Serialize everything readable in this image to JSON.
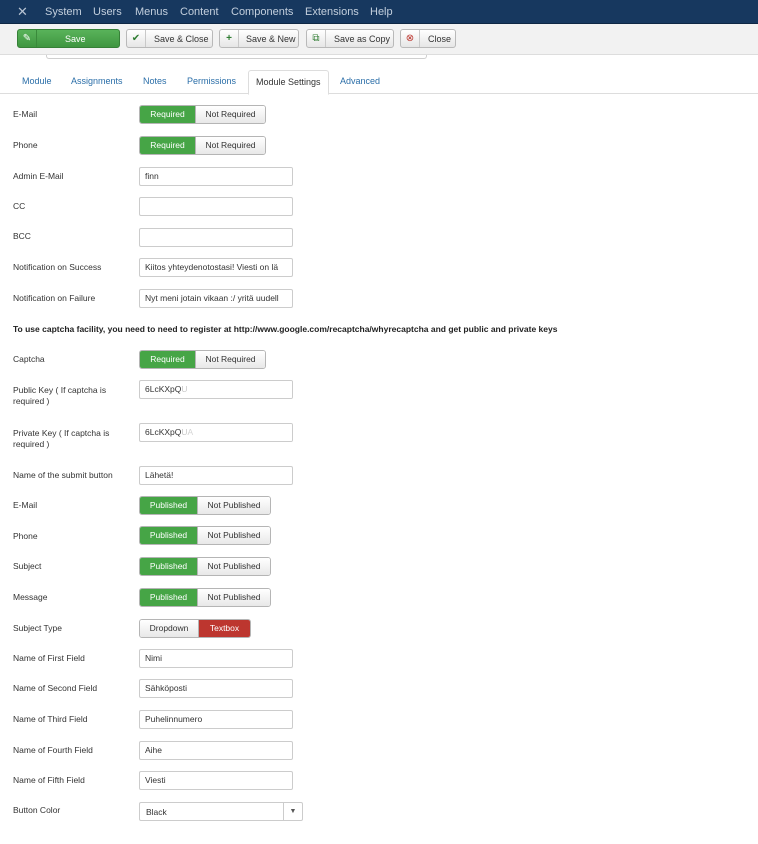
{
  "menubar": {
    "logo_icon": "joomla-logo-icon",
    "items": [
      "System",
      "Users",
      "Menus",
      "Content",
      "Components",
      "Extensions",
      "Help"
    ]
  },
  "toolbar": {
    "save": "Save",
    "save_close": "Save & Close",
    "save_new": "Save & New",
    "save_copy": "Save as Copy",
    "close": "Close"
  },
  "tabs": [
    "Module",
    "Assignments",
    "Notes",
    "Permissions",
    "Module Settings",
    "Advanced"
  ],
  "active_tab": "Module Settings",
  "form": {
    "email_required": {
      "label": "E-Mail",
      "options": [
        "Required",
        "Not Required"
      ],
      "selected": "Required"
    },
    "phone_required": {
      "label": "Phone",
      "options": [
        "Required",
        "Not Required"
      ],
      "selected": "Required"
    },
    "admin_email": {
      "label": "Admin E-Mail",
      "value": "finn"
    },
    "cc": {
      "label": "CC",
      "value": ""
    },
    "bcc": {
      "label": "BCC",
      "value": ""
    },
    "notification_success": {
      "label": "Notification on Success",
      "value": "Kiitos yhteydenotostasi! Viesti on lä"
    },
    "notification_failure": {
      "label": "Notification on Failure",
      "value": "Nyt meni jotain vikaan :/ yritä uudell"
    },
    "captcha_note": "To use captcha facility, you need to need to register at http://www.google.com/recaptcha/whyrecaptcha and get public and private keys",
    "captcha": {
      "label": "Captcha",
      "options": [
        "Required",
        "Not Required"
      ],
      "selected": "Required"
    },
    "public_key": {
      "label": "Public Key ( If captcha is required )",
      "value": "6LcKXpQU"
    },
    "private_key": {
      "label": "Private Key ( If captcha is required )",
      "value": "6LcKXpQUA"
    },
    "submit_name": {
      "label": "Name of the submit button",
      "value": "Lähetä!"
    },
    "email_published": {
      "label": "E-Mail",
      "options": [
        "Published",
        "Not Published"
      ],
      "selected": "Published"
    },
    "phone_published": {
      "label": "Phone",
      "options": [
        "Published",
        "Not Published"
      ],
      "selected": "Published"
    },
    "subject_published": {
      "label": "Subject",
      "options": [
        "Published",
        "Not Published"
      ],
      "selected": "Published"
    },
    "message_published": {
      "label": "Message",
      "options": [
        "Published",
        "Not Published"
      ],
      "selected": "Published"
    },
    "subject_type": {
      "label": "Subject Type",
      "options": [
        "Dropdown",
        "Textbox"
      ],
      "selected": "Textbox"
    },
    "first_field": {
      "label": "Name of First Field",
      "value": "Nimi"
    },
    "second_field": {
      "label": "Name of Second Field",
      "value": "Sähköposti"
    },
    "third_field": {
      "label": "Name of Third Field",
      "value": "Puhelinnumero"
    },
    "fourth_field": {
      "label": "Name of Fourth Field",
      "value": "Aihe"
    },
    "fifth_field": {
      "label": "Name of Fifth Field",
      "value": "Viesti"
    },
    "button_color": {
      "label": "Button Color",
      "value": "Black"
    }
  },
  "colors": {
    "menubar": "#17385f",
    "success": "#46a546",
    "danger": "#bd362f",
    "link": "#2a6ea8"
  }
}
